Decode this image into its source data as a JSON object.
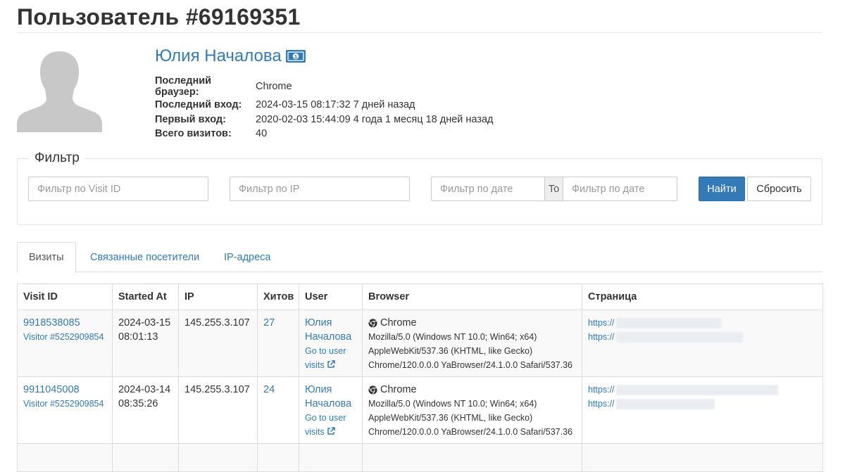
{
  "page": {
    "title": "Пользователь #69169351"
  },
  "user": {
    "name": "Юлия Началова",
    "fields": [
      {
        "label": "Последний браузер:",
        "value": "Chrome"
      },
      {
        "label": "Последний вход:",
        "value": "2024-03-15 08:17:32 7 дней назад"
      },
      {
        "label": "Первый вход:",
        "value": "2020-02-03 15:44:09 4 года 1 месяц 18 дней назад"
      },
      {
        "label": "Всего визитов:",
        "value": "40"
      }
    ]
  },
  "filter": {
    "legend": "Фильтр",
    "visit_id_placeholder": "Фильтр по Visit ID",
    "ip_placeholder": "Фильтр по IP",
    "date_from_placeholder": "Фильтр по дате",
    "to_label": "To",
    "date_to_placeholder": "Фильтр по дате",
    "find_label": "Найти",
    "reset_label": "Сбросить"
  },
  "tabs": [
    {
      "label": "Визиты",
      "active": true
    },
    {
      "label": "Связанные посетители",
      "active": false
    },
    {
      "label": "IP-адреса",
      "active": false
    }
  ],
  "table": {
    "headers": [
      "Visit ID",
      "Started At",
      "IP",
      "Хитов",
      "User",
      "Browser",
      "Страница"
    ],
    "rows": [
      {
        "visit_id": "9918538085",
        "visitor": "Visitor #5252909854",
        "date": "2024-03-15",
        "time": "08:01:13",
        "ip": "145.255.3.107",
        "hits": "27",
        "user_first": "Юлия",
        "user_last": "Началова",
        "go_to_user": "Go to user",
        "visits": "visits",
        "browser": "Chrome",
        "ua_lines": [
          "Mozilla/5.0 (Windows NT 10.0; Win64; x64)",
          "AppleWebKit/537.36 (KHTML, like Gecko)",
          "Chrome/120.0.0.0 YaBrowser/24.1.0.0 Safari/537.36"
        ],
        "page_links": [
          "https://",
          "https://"
        ]
      },
      {
        "visit_id": "9911045008",
        "visitor": "Visitor #5252909854",
        "date": "2024-03-14",
        "time": "08:35:26",
        "ip": "145.255.3.107",
        "hits": "24",
        "user_first": "Юлия",
        "user_last": "Началова",
        "go_to_user": "Go to user",
        "visits": "visits",
        "browser": "Chrome",
        "ua_lines": [
          "Mozilla/5.0 (Windows NT 10.0; Win64; x64)",
          "AppleWebKit/537.36 (KHTML, like Gecko)",
          "Chrome/120.0.0.0 YaBrowser/24.1.0.0 Safari/537.36"
        ],
        "page_links": [
          "https://",
          "https://"
        ]
      }
    ]
  },
  "icons": {
    "avatar": "user-silhouette-icon",
    "money": "money-bill-icon",
    "browser": "chrome-icon",
    "external": "external-link-icon"
  },
  "colors": {
    "link": "#337ab7",
    "primary_button": "#337ab7",
    "avatar_gray": "#c8c8c8"
  }
}
